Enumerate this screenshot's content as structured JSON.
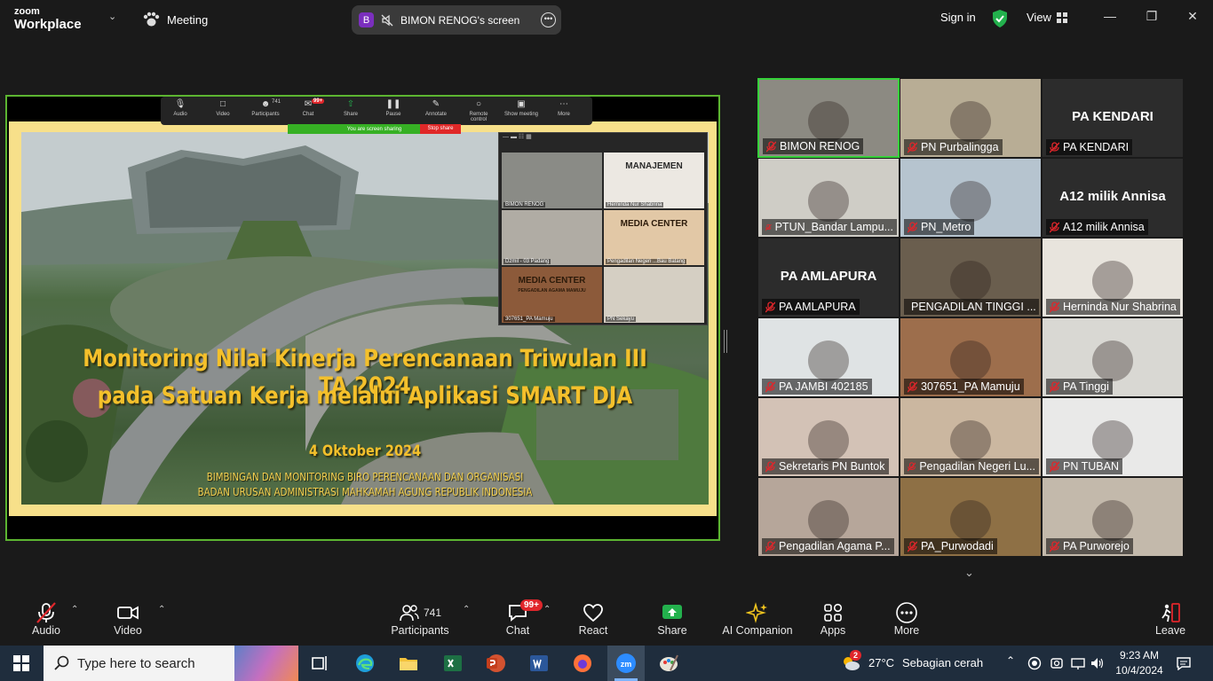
{
  "titlebar": {
    "logo_top": "zoom",
    "logo_bottom": "Workplace",
    "meeting_label": "Meeting",
    "share_avatar": "B",
    "share_label": "BIMON RENOG's screen",
    "signin": "Sign in",
    "view": "View"
  },
  "mini_toolbar": {
    "items": [
      {
        "label": "Audio",
        "icon": "mic-off-icon"
      },
      {
        "label": "Video",
        "icon": "video-icon"
      },
      {
        "label": "Participants",
        "icon": "participants-icon",
        "count": "741"
      },
      {
        "label": "Chat",
        "icon": "chat-icon",
        "badge": "99+"
      },
      {
        "label": "Share",
        "icon": "share-icon"
      },
      {
        "label": "Pause",
        "icon": "pause-icon"
      },
      {
        "label": "Annotate",
        "icon": "pencil-icon"
      },
      {
        "label": "Remote control",
        "icon": "mouse-icon"
      },
      {
        "label": "Show meeting",
        "icon": "window-icon"
      },
      {
        "label": "More",
        "icon": "more-icon"
      }
    ],
    "sharing_notice": "You are screen sharing",
    "stop_share": "Stop share"
  },
  "slide": {
    "title_line1": "Monitoring Nilai Kinerja Perencanaan Triwulan III TA 2024",
    "title_line2": "pada Satuan Kerja melalui Aplikasi SMART DJA",
    "date": "4 Oktober 2024",
    "org_line1": "BIMBINGAN DAN MONITORING BIRO PERENCANAAN DAN ORGANISASI",
    "org_line2": "BADAN URUSAN ADMINISTRASI MAHKAMAH AGUNG REPUBLIK INDONESIA"
  },
  "mini_gallery": {
    "tiles": [
      {
        "name": "BIMON RENOG"
      },
      {
        "name": "Herninda Nur Shabrina",
        "overlay": "MANAJEMEN"
      },
      {
        "name": "Dzmil - 03 Padang"
      },
      {
        "name": "Pengadilan Negeri ...Bau Batang",
        "overlay": "MEDIA CENTER"
      },
      {
        "name": "307651_PA Mamuju",
        "overlay": "MEDIA CENTER",
        "overlay2": "PENGADILAN AGAMA MAMUJU"
      },
      {
        "name": "PN Sekayu"
      }
    ]
  },
  "gallery": {
    "tiles": [
      {
        "name": "BIMON RENOG",
        "active": true,
        "bg": "#8c8a82"
      },
      {
        "name": "PN Purbalingga",
        "bg": "#b8ad95"
      },
      {
        "name": "PA KENDARI",
        "big": "PA KENDARI",
        "bg": "#2c2c2c"
      },
      {
        "name": "PTUN_Bandar Lampu...",
        "bg": "#cfcdc6"
      },
      {
        "name": "PN_Metro",
        "bg": "#b6c4cf"
      },
      {
        "name": "A12 milik Annisa",
        "big": "A12 milik Annisa",
        "bg": "#2c2c2c"
      },
      {
        "name": "PA AMLAPURA",
        "big": "PA AMLAPURA",
        "bg": "#2c2c2c"
      },
      {
        "name": "PENGADILAN TINGGI ...",
        "bg": "#6a5e4e"
      },
      {
        "name": "Herninda Nur Shabrina",
        "bg": "#e8e4dd"
      },
      {
        "name": "PA JAMBI 402185",
        "bg": "#dfe3e4"
      },
      {
        "name": "307651_PA Mamuju",
        "bg": "#9d6e4c"
      },
      {
        "name": "PA Tinggi",
        "bg": "#d9d8d3"
      },
      {
        "name": "Sekretaris PN Buntok",
        "bg": "#d3c2b6"
      },
      {
        "name": "Pengadilan Negeri Lu...",
        "bg": "#cbb7a0"
      },
      {
        "name": "PN TUBAN",
        "bg": "#e9e9e8"
      },
      {
        "name": "Pengadilan Agama P...",
        "bg": "#b6a69a"
      },
      {
        "name": "PA_Purwodadi",
        "bg": "#8e7045"
      },
      {
        "name": "PA Purworejo",
        "bg": "#c3b9ab"
      }
    ]
  },
  "toolbar": {
    "audio": "Audio",
    "video": "Video",
    "participants": "Participants",
    "participants_count": "741",
    "chat": "Chat",
    "chat_badge": "99+",
    "react": "React",
    "share": "Share",
    "ai_companion": "AI Companion",
    "apps": "Apps",
    "more": "More",
    "leave": "Leave"
  },
  "taskbar": {
    "search_placeholder": "Type here to search",
    "weather_badge": "2",
    "temperature": "27°C",
    "weather": "Sebagian cerah",
    "time": "9:23 AM",
    "date": "10/4/2024"
  },
  "colors": {
    "active_border": "#36d13a",
    "share_green": "#36b024",
    "stop_red": "#e02828",
    "slide_gold": "#f4c02b"
  }
}
